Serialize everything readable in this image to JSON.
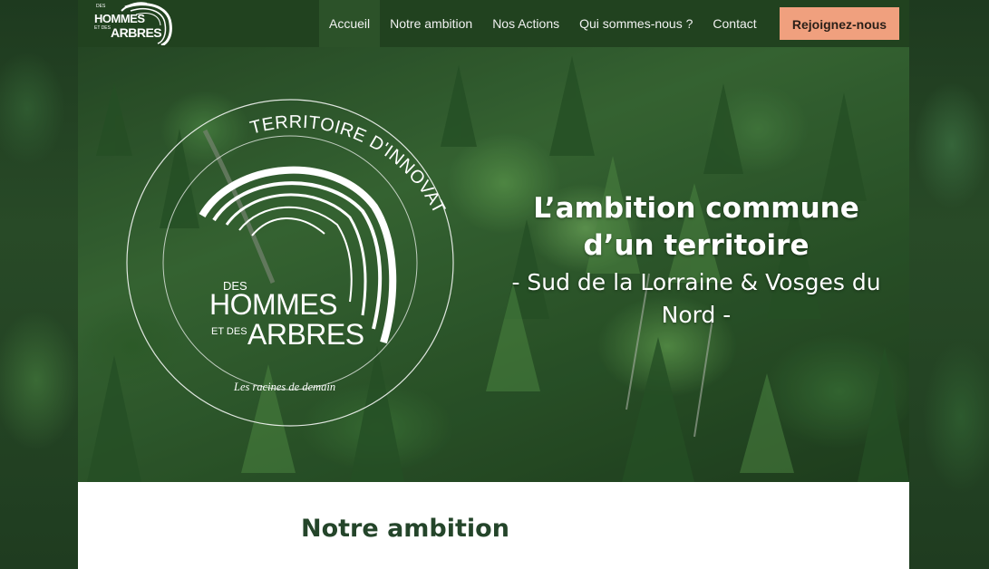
{
  "navbar": {
    "logo": {
      "line_top": "DES",
      "line1": "HOMMES",
      "line2_small": "ET DES",
      "line2": "ARBRES"
    },
    "items": [
      {
        "label": "Accueil",
        "active": true
      },
      {
        "label": "Notre ambition",
        "active": false
      },
      {
        "label": "Nos Actions",
        "active": false
      },
      {
        "label": "Qui sommes-nous ?",
        "active": false
      },
      {
        "label": "Contact",
        "active": false
      }
    ],
    "cta_label": "Rejoignez-nous"
  },
  "hero": {
    "emblem": {
      "arc_text": "TERRITOIRE D'INNOVATION",
      "des": "DES",
      "hommes": "HOMMES",
      "et_des": "ET DES",
      "arbres": "ARBRES",
      "tagline": "Les racines de demain"
    },
    "title": "L’ambition commune d’un territoire",
    "subtitle": "- Sud de la Lorraine & Vosges du Nord -"
  },
  "content": {
    "section_title": "Notre ambition"
  },
  "colors": {
    "navbar_bg": "#21421f",
    "cta_bg": "#f0a07e",
    "section_title": "#24452a"
  }
}
